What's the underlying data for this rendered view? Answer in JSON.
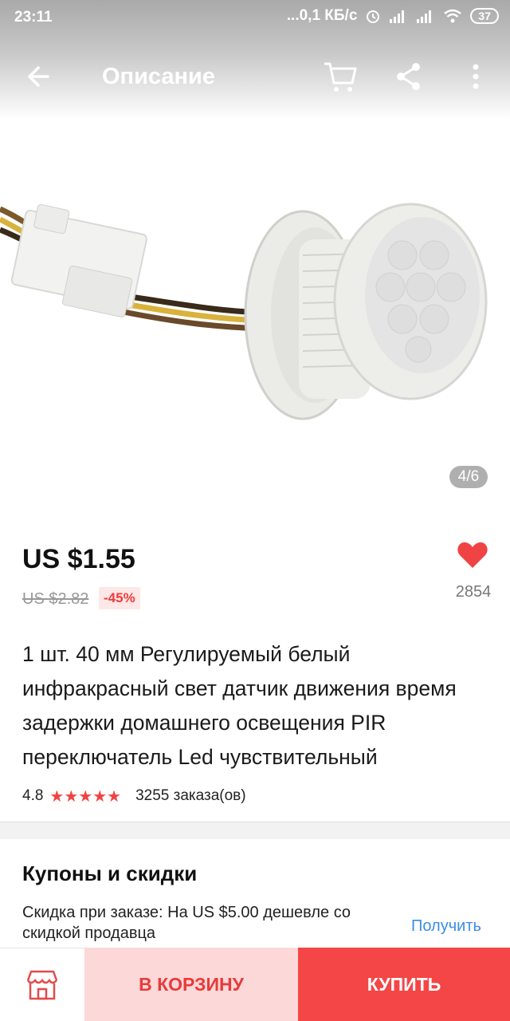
{
  "status_bar": {
    "time": "23:11",
    "network_speed": "...0,1 КБ/с",
    "battery": "37"
  },
  "toolbar": {
    "title": "Описание"
  },
  "gallery": {
    "counter": "4/6"
  },
  "product": {
    "price": "US $1.55",
    "old_price": "US $2.82",
    "discount": "-45%",
    "favorites_count": "2854",
    "title": "1 шт. 40 мм Регулируемый белый инфракрасный свет датчик движения время задержки домашнего освещения PIR переключатель Led чувствительный",
    "rating": "4.8",
    "rating_value": 4.8,
    "stars": "★★★★★",
    "orders": "3255 заказа(ов)"
  },
  "coupons": {
    "heading": "Купоны и скидки",
    "text": "Скидка при заказе: На US $5.00 дешевле со скидкой продавца",
    "get_label": "Получить"
  },
  "bottom_bar": {
    "cart_label": "В КОРЗИНУ",
    "buy_label": "КУПИТЬ"
  },
  "colors": {
    "accent": "#f44646",
    "accent_light": "#fcd8d8",
    "link": "#3a8ee6",
    "star": "#f04343"
  },
  "icons": {
    "back": "arrow-left-icon",
    "cart": "shopping-cart-icon",
    "share": "share-icon",
    "more": "more-vertical-icon",
    "favorite": "heart-icon",
    "store": "store-icon"
  }
}
